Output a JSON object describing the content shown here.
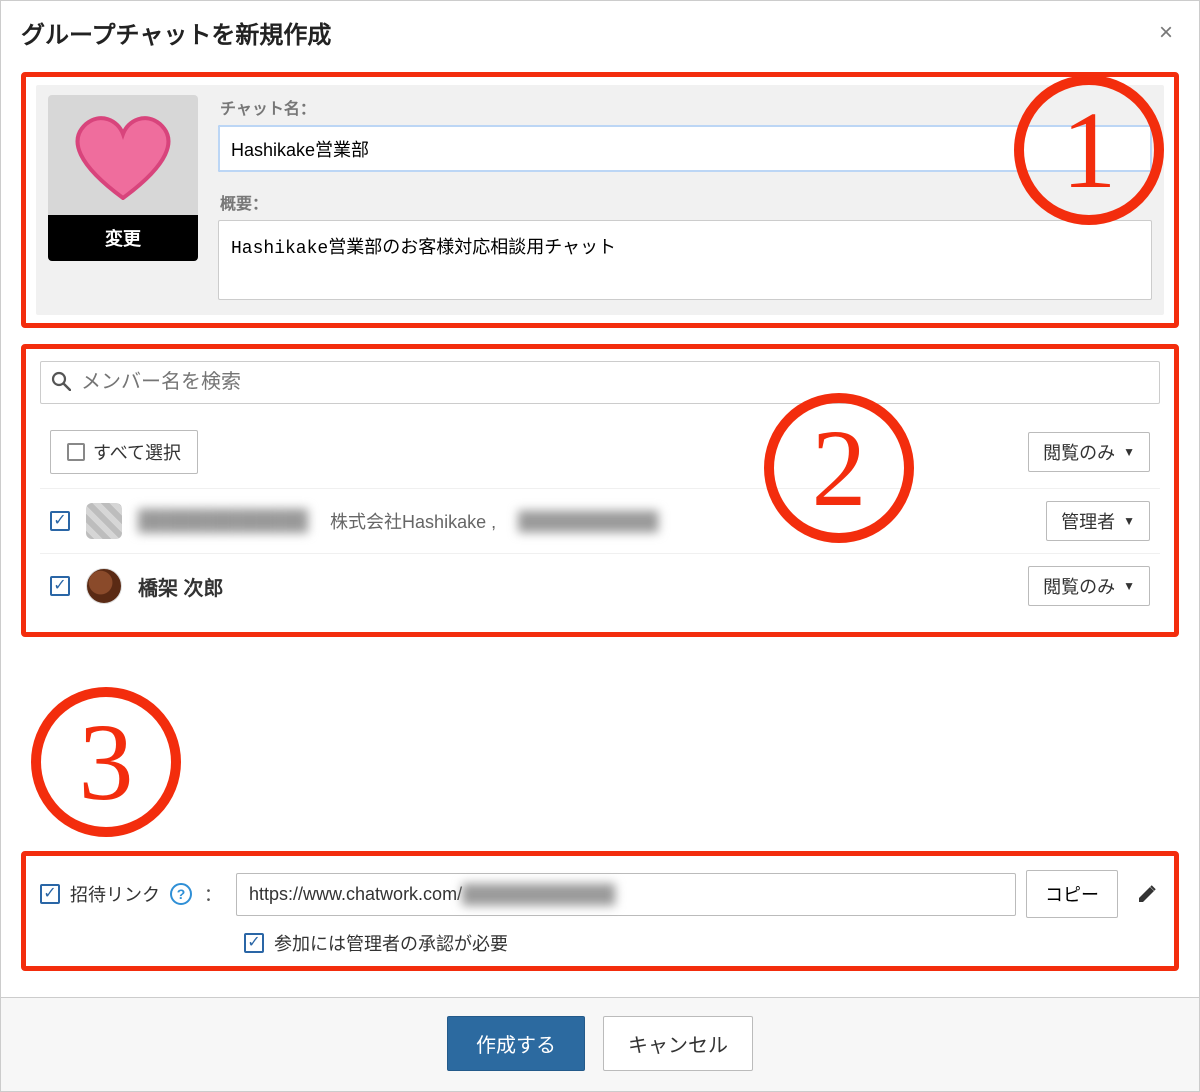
{
  "dialog": {
    "title": "グループチャットを新規作成",
    "close_glyph": "×"
  },
  "avatar": {
    "change_label": "変更"
  },
  "fields": {
    "chat_name_label": "チャット名：",
    "chat_name_value": "Hashikake営業部",
    "overview_label": "概要：",
    "overview_value": "Hashikake営業部のお客様対応相談用チャット"
  },
  "search": {
    "placeholder": "メンバー名を検索"
  },
  "select_all": {
    "label": "すべて選択"
  },
  "default_role": "閲覧のみ",
  "members": [
    {
      "checked": true,
      "name_hidden": true,
      "org": "株式会社Hashikake ,",
      "org_suffix_hidden": true,
      "role": "管理者"
    },
    {
      "checked": true,
      "name": "橋架 次郎",
      "role": "閲覧のみ"
    }
  ],
  "invite": {
    "checked": true,
    "label": "招待リンク",
    "colon": "：",
    "url_visible": "https://www.chatwork.com/",
    "copy_label": "コピー",
    "approval_checked": true,
    "approval_label": "参加には管理者の承認が必要"
  },
  "actions": {
    "create": "作成する",
    "cancel": "キャンセル"
  },
  "badges": {
    "one": "1",
    "two": "2",
    "three": "3"
  }
}
